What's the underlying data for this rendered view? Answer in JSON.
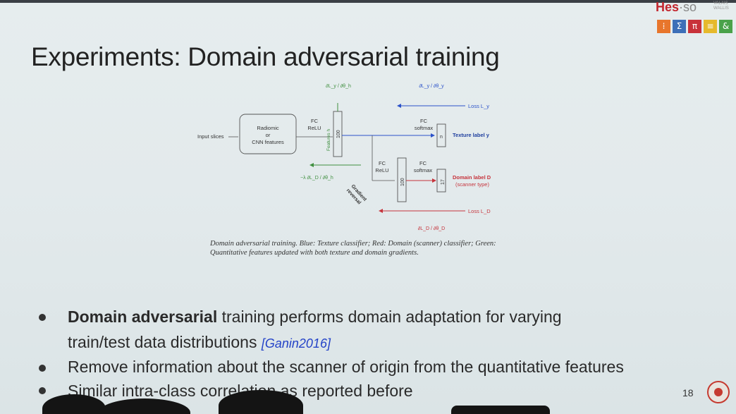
{
  "slide": {
    "title": "Experiments: Domain adversarial training",
    "page_number": "18"
  },
  "logo": {
    "brand": "Hes",
    "so": "·so",
    "sub_line1": "VALAIS",
    "sub_line2": "WALLIS",
    "squares": [
      {
        "glyph": "⁞",
        "color": "#e8762c"
      },
      {
        "glyph": "Σ",
        "color": "#3d6fb8"
      },
      {
        "glyph": "π",
        "color": "#c8323a"
      },
      {
        "glyph": "≡",
        "color": "#e6b92c"
      },
      {
        "glyph": "&",
        "color": "#4aa24a"
      }
    ]
  },
  "diagram": {
    "input_label": "Input slices",
    "extractor_line1": "Radiomic",
    "extractor_line2": "or",
    "extractor_line3": "CNN features",
    "fc1_line1": "FC",
    "fc1_line2": "ReLU",
    "features_label": "Features h",
    "features_size": "100",
    "theta_h": "∂L_y / ∂θ_h",
    "theta_y": "∂L_y / ∂θ_y",
    "loss_y": "Loss L_y",
    "fc_tex_line1": "FC",
    "fc_tex_line2": "softmax",
    "texture_size": "n",
    "texture_label": "Texture label y",
    "fc2_line1": "FC",
    "fc2_line2": "ReLU",
    "domain_hidden_size": "100",
    "fc_dom_line1": "FC",
    "fc_dom_line2": "softmax",
    "domain_size": "17",
    "domain_label_line1": "Domain label D",
    "domain_label_line2": "(scanner type)",
    "neg_lambda_grad": "−λ ∂L_D / ∂θ_h",
    "grad_reversal_line1": "Gradient",
    "grad_reversal_line2": "reversal",
    "loss_d": "Loss L_D",
    "theta_d": "∂L_D / ∂θ_D",
    "colors": {
      "blue": "#2b52c9",
      "red": "#c6343c",
      "green": "#3f8f3f"
    }
  },
  "caption": "Domain adversarial training. Blue: Texture classifier; Red: Domain (scanner) classifier; Green: Quantitative features updated with both texture and domain gradients.",
  "bullets": {
    "b1_bold": "Domain adversarial",
    "b1_rest": " training performs domain adaptation for varying",
    "b1_line2": "train/test data distributions ",
    "b1_cite": "[Ganin2016]",
    "b2": "Remove information about the scanner of origin from the quantitative features",
    "b3": "Similar intra-class correlation as reported before"
  }
}
